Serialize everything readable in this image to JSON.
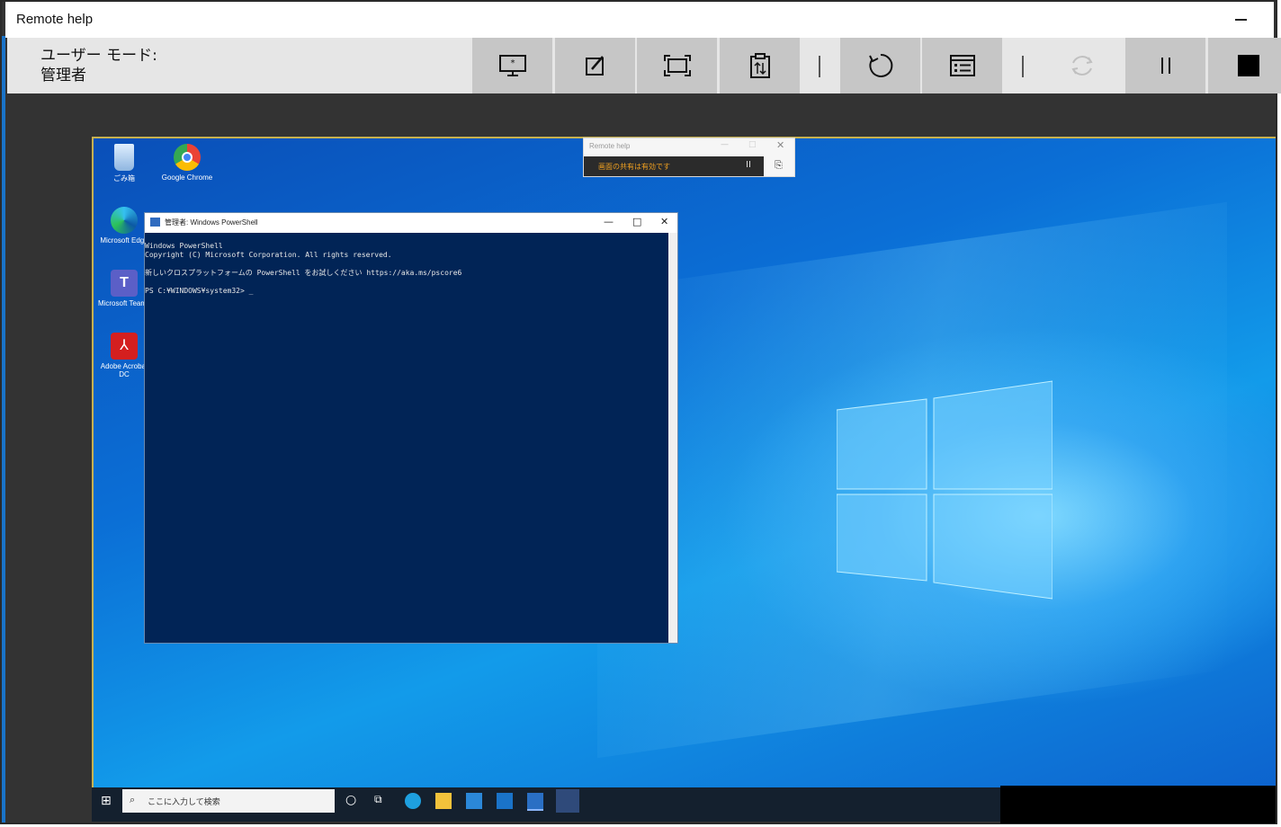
{
  "window": {
    "title": "Remote help"
  },
  "toolbar": {
    "mode_label": "ユーザー モード:",
    "mode_value": "管理者",
    "buttons": [
      {
        "name": "display-icon"
      },
      {
        "name": "annotate-icon"
      },
      {
        "name": "fullscreen-icon"
      },
      {
        "name": "clipboard-icon"
      },
      {
        "name": "restart-icon"
      },
      {
        "name": "task-manager-icon"
      },
      {
        "name": "refresh-icon"
      },
      {
        "name": "pause-icon"
      },
      {
        "name": "stop-icon"
      }
    ]
  },
  "remote_desktop": {
    "icons": [
      {
        "label": "ごみ箱",
        "name": "recycle-bin-icon"
      },
      {
        "label": "Google Chrome",
        "name": "chrome-icon"
      },
      {
        "label": "Microsoft Edge",
        "name": "edge-icon"
      },
      {
        "label": "Microsoft Teams",
        "name": "teams-icon"
      },
      {
        "label": "Adobe Acrobat DC",
        "name": "acrobat-icon"
      }
    ],
    "powershell": {
      "title": "管理者: Windows PowerShell",
      "lines": [
        "Windows PowerShell",
        "Copyright (C) Microsoft Corporation. All rights reserved.",
        "",
        "新しいクロスプラットフォームの PowerShell をお試しください https://aka.ms/pscore6",
        "",
        "PS C:¥WINDOWS¥system32> _"
      ]
    },
    "remote_help_mini": {
      "title": "Remote help",
      "status": "画面の共有は有効です"
    },
    "taskbar": {
      "search_placeholder": "ここに入力して検索"
    }
  },
  "colors": {
    "toolbar_bg": "#e6e6e6",
    "button_bg": "#c6c6c6",
    "console_bg": "#012456",
    "desktop_blue": "#0b6fd6"
  }
}
